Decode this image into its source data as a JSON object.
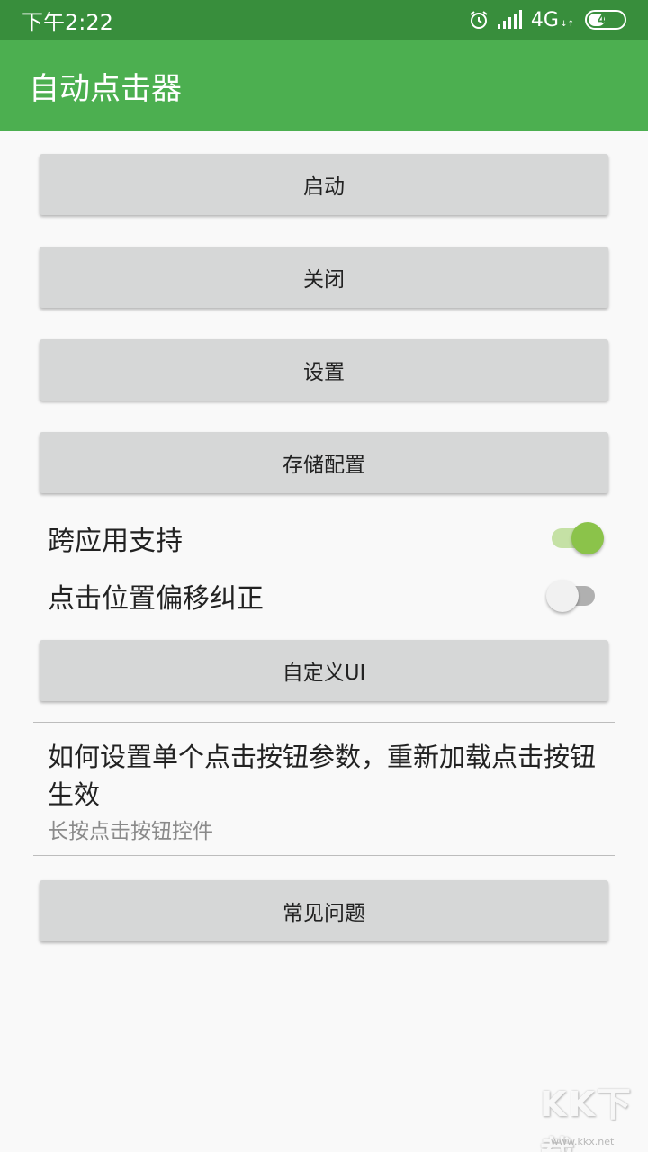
{
  "status_bar": {
    "time": "下午2:22",
    "network": "4G",
    "network_sub": "↓↑",
    "battery": "48",
    "battery_level": 0.48,
    "icons": [
      "alarm-icon",
      "signal-icon",
      "battery-icon"
    ]
  },
  "app_bar": {
    "title": "自动点击器"
  },
  "buttons": {
    "start": "启动",
    "close": "关闭",
    "settings": "设置",
    "save_config": "存储配置",
    "custom_ui": "自定义UI",
    "faq": "常见问题"
  },
  "switches": [
    {
      "label": "跨应用支持",
      "checked": true
    },
    {
      "label": "点击位置偏移纠正",
      "checked": false
    }
  ],
  "info": {
    "title": "如何设置单个点击按钮参数，重新加载点击按钮生效",
    "subtitle": "长按点击按钮控件"
  },
  "watermark": {
    "text": "KK下载",
    "url": "www.kkx.net"
  },
  "colors": {
    "status_bar": "#388e3c",
    "app_bar": "#4caf50",
    "switch_on_thumb": "#8bc34a",
    "switch_on_track": "#c5e1a5",
    "switch_off_thumb": "#f1f1f1",
    "switch_off_track": "#b0b0b0"
  }
}
